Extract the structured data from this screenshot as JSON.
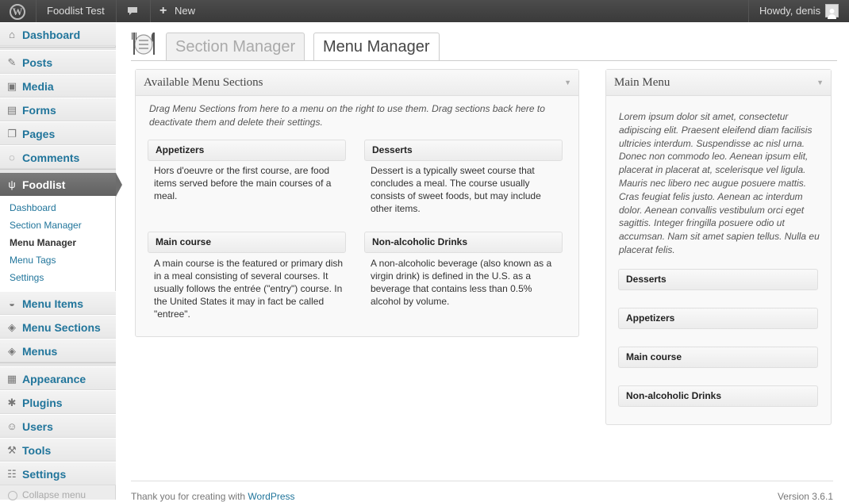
{
  "adminbar": {
    "site_name": "Foodlist Test",
    "new_label": "New",
    "greeting": "Howdy, denis"
  },
  "sidebar": {
    "items": [
      {
        "label": "Dashboard",
        "icon": "dashboard-icon"
      },
      {
        "label": "Posts",
        "icon": "pushpin-icon"
      },
      {
        "label": "Media",
        "icon": "media-icon"
      },
      {
        "label": "Forms",
        "icon": "forms-icon"
      },
      {
        "label": "Pages",
        "icon": "pages-icon"
      },
      {
        "label": "Comments",
        "icon": "comments-icon"
      },
      {
        "label": "Foodlist",
        "icon": "fork-knife-icon"
      },
      {
        "label": "Menu Items",
        "icon": "bowl-icon"
      },
      {
        "label": "Menu Sections",
        "icon": "section-icon"
      },
      {
        "label": "Menus",
        "icon": "menu-icon"
      },
      {
        "label": "Appearance",
        "icon": "appearance-icon"
      },
      {
        "label": "Plugins",
        "icon": "plugin-icon"
      },
      {
        "label": "Users",
        "icon": "users-icon"
      },
      {
        "label": "Tools",
        "icon": "tools-icon"
      },
      {
        "label": "Settings",
        "icon": "settings-icon"
      }
    ],
    "submenu": [
      "Dashboard",
      "Section Manager",
      "Menu Manager",
      "Menu Tags",
      "Settings"
    ],
    "collapse_label": "Collapse menu"
  },
  "tabs": {
    "section_manager": "Section Manager",
    "menu_manager": "Menu Manager"
  },
  "available": {
    "title": "Available Menu Sections",
    "description": "Drag Menu Sections from here to a menu on the right to use them. Drag sections back here to deactivate them and delete their settings.",
    "sections": [
      {
        "title": "Appetizers",
        "desc": "Hors d'oeuvre or the first course, are food items served before the main courses of a meal."
      },
      {
        "title": "Desserts",
        "desc": "Dessert is a typically sweet course that concludes a meal. The course usually consists of sweet foods, but may include other items."
      },
      {
        "title": "Main course",
        "desc": "A main course is the featured or primary dish in a meal consisting of several courses. It usually follows the entrée (\"entry\") course. In the United States it may in fact be called \"entree\"."
      },
      {
        "title": "Non-alcoholic Drinks",
        "desc": "A non-alcoholic beverage (also known as a virgin drink) is defined in the U.S. as a beverage that contains less than 0.5% alcohol by volume."
      }
    ]
  },
  "main_menu": {
    "title": "Main Menu",
    "description": "Lorem ipsum dolor sit amet, consectetur adipiscing elit. Praesent eleifend diam facilisis ultricies interdum. Suspendisse ac nisl urna. Donec non commodo leo. Aenean ipsum elit, placerat in placerat at, scelerisque vel ligula. Mauris nec libero nec augue posuere mattis. Cras feugiat felis justo. Aenean ac interdum dolor. Aenean convallis vestibulum orci eget sagittis. Integer fringilla posuere odio ut accumsan. Nam sit amet sapien tellus. Nulla eu placerat felis.",
    "sections": [
      "Desserts",
      "Appetizers",
      "Main course",
      "Non-alcoholic Drinks"
    ]
  },
  "footer": {
    "thanks": "Thank you for creating with ",
    "link": "WordPress",
    "version": "Version 3.6.1"
  }
}
